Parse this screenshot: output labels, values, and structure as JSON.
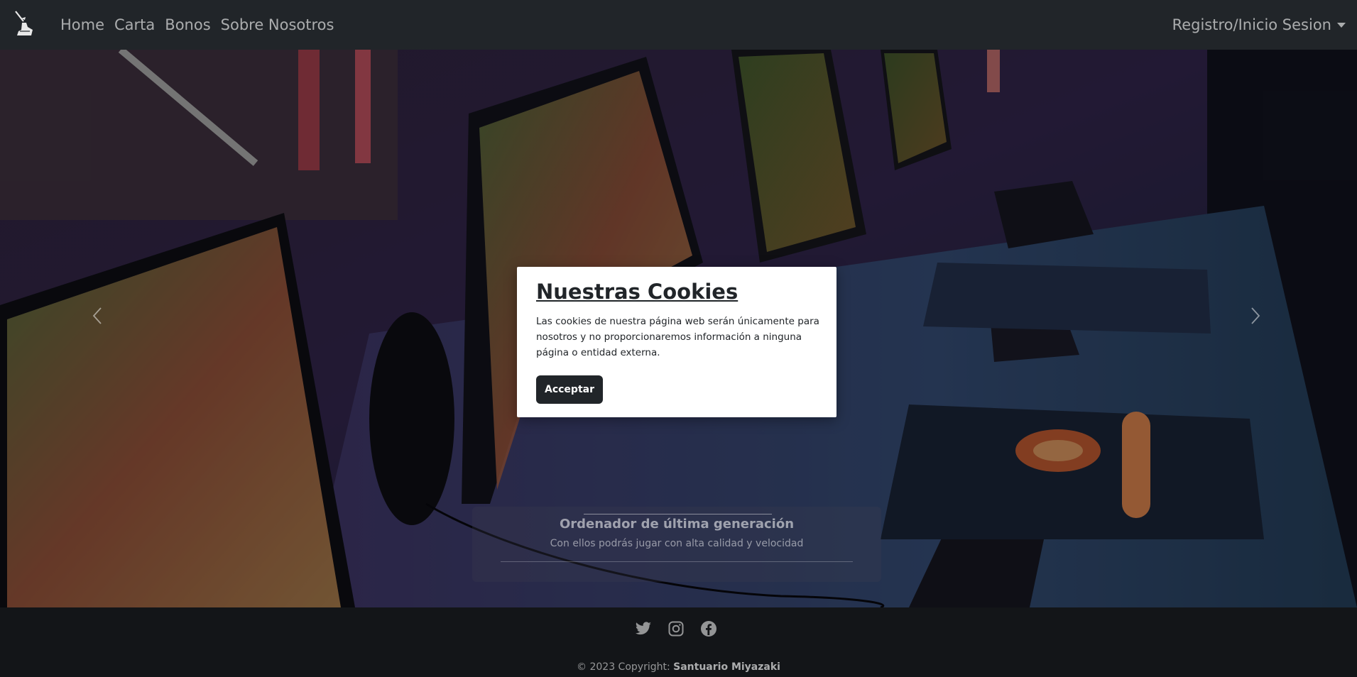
{
  "navbar": {
    "brand_icon": "sword-in-stone-logo",
    "links": [
      "Home",
      "Carta",
      "Bonos",
      "Sobre Nosotros"
    ],
    "account_menu_label": "Registro/Inicio Sesion"
  },
  "carousel": {
    "slide_caption_title": "Ordenador de última generación",
    "slide_caption_text": "Con ellos podrás jugar con alta calidad y velocidad",
    "prev_icon": "chevron-left-icon",
    "next_icon": "chevron-right-icon"
  },
  "cookie_modal": {
    "title": "Nuestras Cookies",
    "text": "Las cookies de nuestra página web serán únicamente para nosotros y no proporcionaremos información a ninguna página o entidad externa.",
    "accept_label": "Acceptar"
  },
  "footer": {
    "social_icons": [
      "twitter-icon",
      "instagram-icon",
      "facebook-icon"
    ],
    "copyright_prefix": "© 2023 Copyright:",
    "copyright_owner": "Santuario Miyazaki"
  },
  "colors": {
    "navbar_bg": "#212529",
    "footer_bg": "#131518",
    "modal_bg": "#ffffff",
    "button_bg": "#212529"
  }
}
